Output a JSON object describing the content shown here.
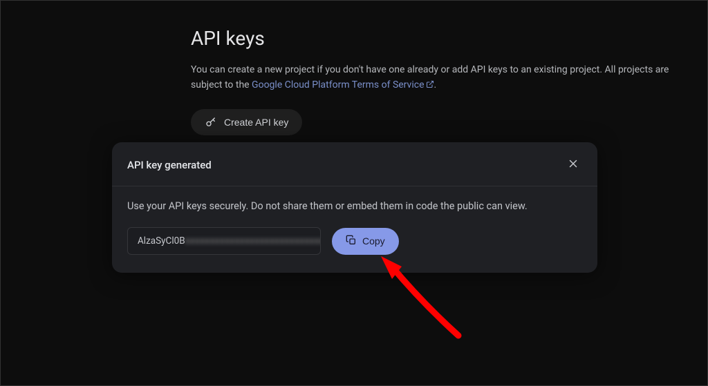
{
  "page": {
    "title": "API keys",
    "description_prefix": "You can create a new project if you don't have one already or add API keys to an existing project. All projects are subject to the ",
    "terms_link_text": "Google Cloud Platform Terms of Service",
    "description_suffix": "."
  },
  "create_button": {
    "label": "Create API key"
  },
  "modal": {
    "title": "API key generated",
    "description": "Use your API keys securely. Do not share them or embed them in code the public can view.",
    "api_key_visible": "AlzaSyCl0B",
    "api_key_obscured": "xxxxxxxxxxxxxxxxxxxxxxxxxxxx",
    "copy_label": "Copy"
  }
}
